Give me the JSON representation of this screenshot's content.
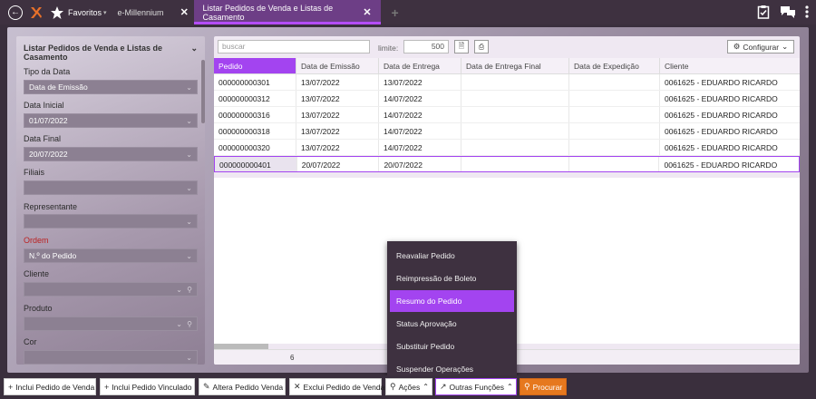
{
  "topbar": {
    "favorites_label": "Favoritos",
    "tabs": [
      {
        "label": "e-Millennium",
        "close": "✕"
      },
      {
        "label": "Listar Pedidos de Venda e Listas de Casamento",
        "close": "✕"
      }
    ],
    "add_tab": "+"
  },
  "sidebar": {
    "title": "Listar Pedidos de Venda e Listas de Casamento",
    "fields": [
      {
        "label": "Tipo da Data",
        "value": "Data de Emissão"
      },
      {
        "label": "Data Inicial",
        "value": "01/07/2022"
      },
      {
        "label": "Data Final",
        "value": "20/07/2022"
      },
      {
        "label": "Filiais",
        "value": ""
      },
      {
        "label": "Representante",
        "value": ""
      },
      {
        "label": "Ordem",
        "value": "N.º do Pedido"
      },
      {
        "label": "Cliente",
        "value": ""
      },
      {
        "label": "Produto",
        "value": ""
      },
      {
        "label": "Cor",
        "value": ""
      }
    ]
  },
  "toolbar": {
    "search_placeholder": "buscar",
    "limit_label": "limite:",
    "limit_value": "500",
    "config_label": "Configurar"
  },
  "grid": {
    "columns": [
      "Pedido",
      "Data de Emissão",
      "Data de Entrega",
      "Data de Entrega Final",
      "Data de Expedição",
      "Cliente"
    ],
    "rows": [
      [
        "000000000301",
        "13/07/2022",
        "13/07/2022",
        "",
        "",
        "0061625 - EDUARDO RICARDO"
      ],
      [
        "000000000312",
        "13/07/2022",
        "14/07/2022",
        "",
        "",
        "0061625 - EDUARDO RICARDO"
      ],
      [
        "000000000316",
        "13/07/2022",
        "14/07/2022",
        "",
        "",
        "0061625 - EDUARDO RICARDO"
      ],
      [
        "000000000318",
        "13/07/2022",
        "14/07/2022",
        "",
        "",
        "0061625 - EDUARDO RICARDO"
      ],
      [
        "000000000320",
        "13/07/2022",
        "14/07/2022",
        "",
        "",
        "0061625 - EDUARDO RICARDO"
      ],
      [
        "000000000401",
        "20/07/2022",
        "20/07/2022",
        "",
        "",
        "0061625 - EDUARDO RICARDO"
      ]
    ],
    "count": "6"
  },
  "menu": {
    "items": [
      "Reavaliar Pedido",
      "Reimpressão de Boleto",
      "Resumo do Pedido",
      "Status Aprovação",
      "Substituir Pedido",
      "Suspender Operações"
    ]
  },
  "bottom": {
    "buttons": [
      "Inclui Pedido de Venda",
      "Inclui Pedido Vinculado",
      "Altera Pedido Venda",
      "Exclui Pedido de Venda",
      "Ações",
      "Outras Funções",
      "Procurar"
    ]
  },
  "colors": {
    "accent": "#a344f0",
    "topbar": "#3e3140",
    "orange": "#e6781e"
  }
}
